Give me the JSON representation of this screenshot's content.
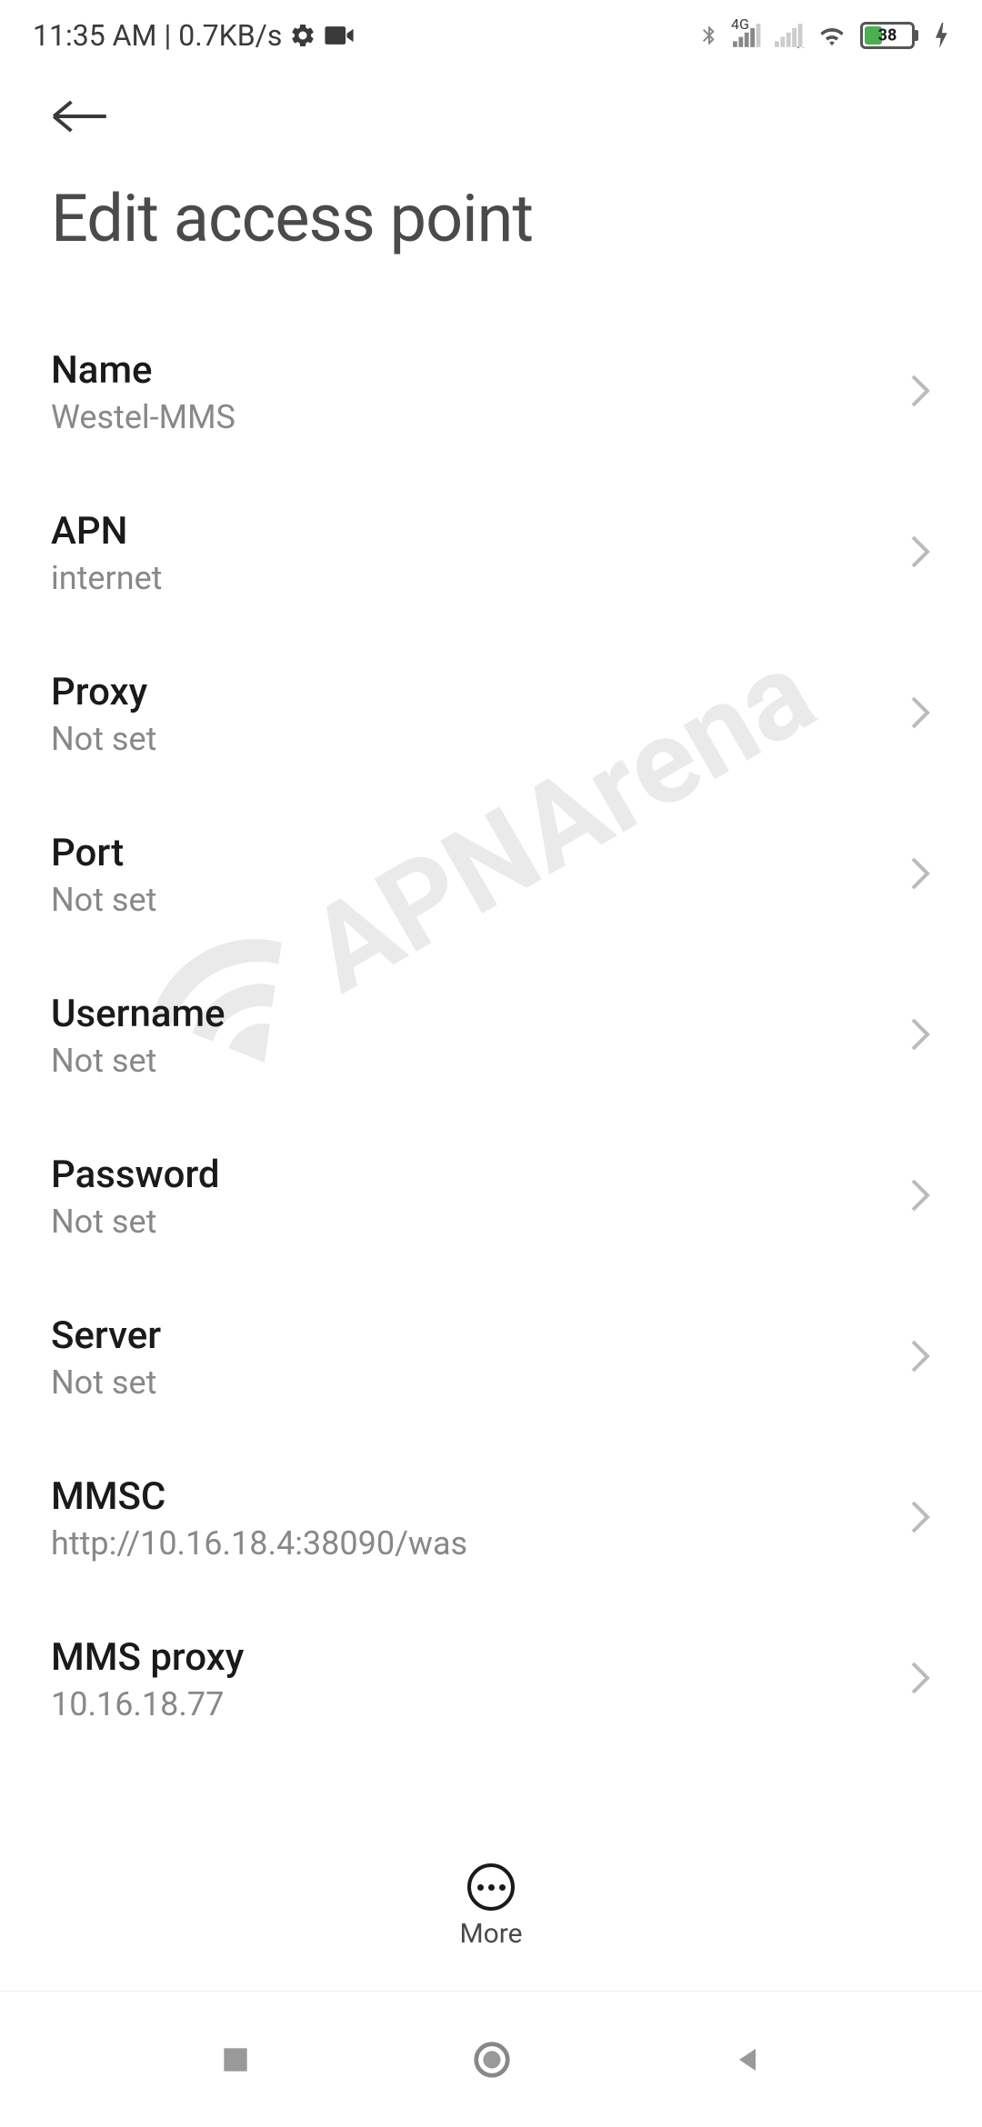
{
  "statusBar": {
    "time": "11:35 AM",
    "dataRate": "0.7KB/s",
    "networkLabel": "4G",
    "batteryPercent": "38"
  },
  "header": {
    "title": "Edit access point"
  },
  "settings": [
    {
      "label": "Name",
      "value": "Westel-MMS"
    },
    {
      "label": "APN",
      "value": "internet"
    },
    {
      "label": "Proxy",
      "value": "Not set"
    },
    {
      "label": "Port",
      "value": "Not set"
    },
    {
      "label": "Username",
      "value": "Not set"
    },
    {
      "label": "Password",
      "value": "Not set"
    },
    {
      "label": "Server",
      "value": "Not set"
    },
    {
      "label": "MMSC",
      "value": "http://10.16.18.4:38090/was"
    },
    {
      "label": "MMS proxy",
      "value": "10.16.18.77"
    }
  ],
  "bottomBar": {
    "moreLabel": "More"
  },
  "watermark": {
    "text": "APNArena"
  }
}
